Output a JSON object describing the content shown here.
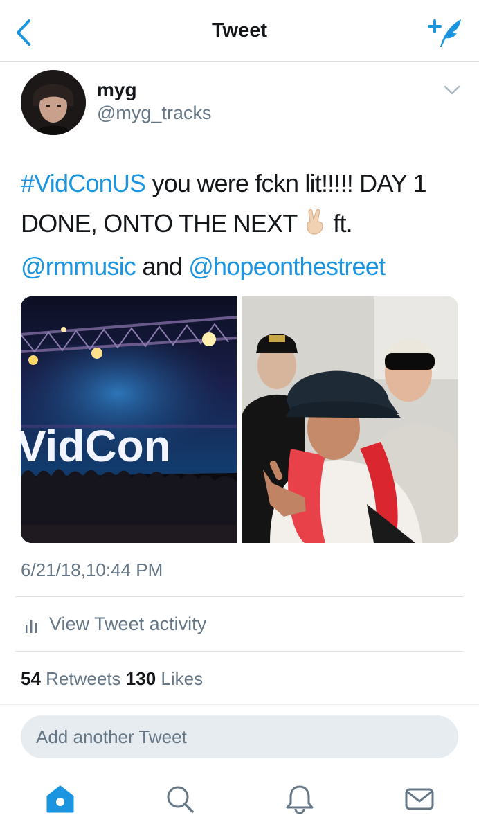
{
  "header": {
    "title": "Tweet"
  },
  "author": {
    "name": "myg",
    "handle": "@myg_tracks"
  },
  "tweet": {
    "hashtag": "#VidConUS",
    "text_1": " you were fckn lit!!!!! DAY 1 DONE, ONTO THE NEXT ",
    "emoji": "✌🏻",
    "text_2": " ft.",
    "mention_1": "@rmmusic",
    "text_3": " and ",
    "mention_2": "@hopeonthestreet"
  },
  "photos": {
    "stage_sign": "VidCon"
  },
  "timestamp": "6/21/18,10:44 PM",
  "activity": {
    "label": "View Tweet activity"
  },
  "stats": {
    "retweets_count": "54",
    "retweets_label": "Retweets",
    "likes_count": "130",
    "likes_label": "Likes"
  },
  "reply": {
    "placeholder": "Add another Tweet"
  },
  "tab_bar": [
    "home-icon",
    "search-icon",
    "notifications-icon",
    "messages-icon"
  ],
  "colors": {
    "accent": "#1b95e0",
    "secondary_text": "#657786",
    "divider": "#d9dfe3"
  }
}
